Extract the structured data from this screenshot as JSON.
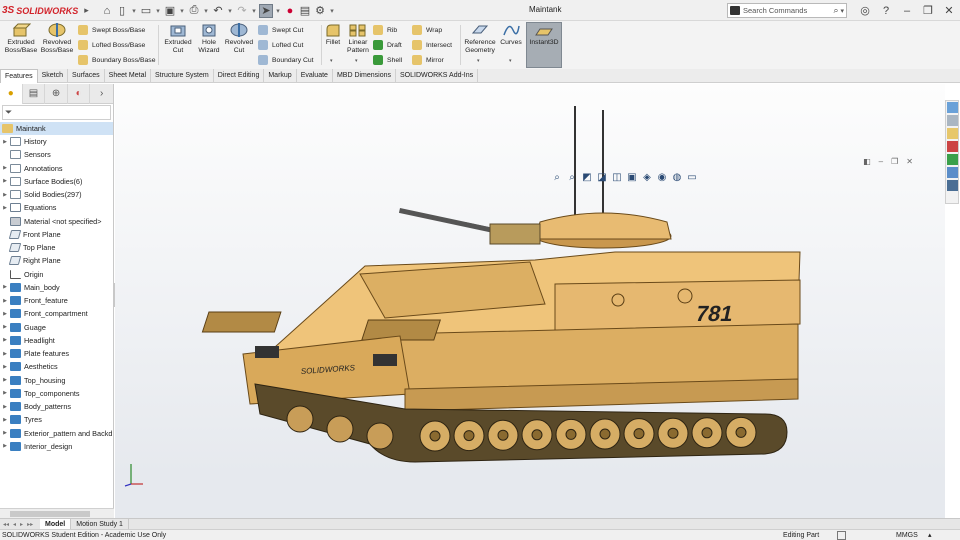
{
  "app": {
    "brand": "SOLIDWORKS",
    "window_title": "Maintank"
  },
  "search": {
    "placeholder": "Search Commands"
  },
  "ribbon": {
    "extruded_boss": "Extruded Boss/Base",
    "revolved_boss": "Revolved Boss/Base",
    "swept_boss": "Swept Boss/Base",
    "lofted_boss": "Lofted Boss/Base",
    "boundary_boss": "Boundary Boss/Base",
    "extruded_cut": "Extruded Cut",
    "hole_wizard": "Hole Wizard",
    "revolved_cut": "Revolved Cut",
    "swept_cut": "Swept Cut",
    "lofted_cut": "Lofted Cut",
    "boundary_cut": "Boundary Cut",
    "fillet": "Fillet",
    "linear_pattern": "Linear Pattern",
    "rib": "Rib",
    "draft": "Draft",
    "shell": "Shell",
    "wrap": "Wrap",
    "intersect": "Intersect",
    "mirror": "Mirror",
    "reference_geometry": "Reference Geometry",
    "curves": "Curves",
    "instant3d": "Instant3D"
  },
  "tabs": [
    "Features",
    "Sketch",
    "Surfaces",
    "Sheet Metal",
    "Structure System",
    "Direct Editing",
    "Markup",
    "Evaluate",
    "MBD Dimensions",
    "SOLIDWORKS Add-Ins"
  ],
  "tree": {
    "root": "Maintank",
    "items": [
      {
        "label": "History",
        "icon": "history-icon",
        "caret": true
      },
      {
        "label": "Sensors",
        "icon": "sensor-icon",
        "caret": false
      },
      {
        "label": "Annotations",
        "icon": "annotation-icon",
        "caret": true
      },
      {
        "label": "Surface Bodies(6)",
        "icon": "surface-bodies-icon",
        "caret": true
      },
      {
        "label": "Solid Bodies(297)",
        "icon": "solid-bodies-icon",
        "caret": true
      },
      {
        "label": "Equations",
        "icon": "equation-icon",
        "caret": true
      },
      {
        "label": "Material <not specified>",
        "icon": "material-icon",
        "caret": false
      },
      {
        "label": "Front Plane",
        "icon": "plane-icon",
        "caret": false
      },
      {
        "label": "Top Plane",
        "icon": "plane-icon",
        "caret": false
      },
      {
        "label": "Right Plane",
        "icon": "plane-icon",
        "caret": false
      },
      {
        "label": "Origin",
        "icon": "origin-icon",
        "caret": false
      },
      {
        "label": "Main_body",
        "icon": "folder-icon",
        "caret": true
      },
      {
        "label": "Front_feature",
        "icon": "folder-icon",
        "caret": true
      },
      {
        "label": "Front_compartment",
        "icon": "folder-icon",
        "caret": true
      },
      {
        "label": "Guage",
        "icon": "folder-icon",
        "caret": true
      },
      {
        "label": "Headlight",
        "icon": "folder-icon",
        "caret": true
      },
      {
        "label": "Plate features",
        "icon": "folder-icon",
        "caret": true
      },
      {
        "label": "Aesthetics",
        "icon": "folder-icon",
        "caret": true
      },
      {
        "label": "Top_housing",
        "icon": "folder-icon",
        "caret": true
      },
      {
        "label": "Top_components",
        "icon": "folder-icon",
        "caret": true
      },
      {
        "label": "Body_patterns",
        "icon": "folder-icon",
        "caret": true
      },
      {
        "label": "Tyres",
        "icon": "folder-icon",
        "caret": true
      },
      {
        "label": "Exterior_pattern and Backd",
        "icon": "folder-icon",
        "caret": true
      },
      {
        "label": "Interior_design",
        "icon": "folder-icon",
        "caret": true
      }
    ]
  },
  "model": {
    "decal_text": "SOLIDWORKS",
    "hull_number": "781",
    "body_color": "#e6b870"
  },
  "bottom_tabs": [
    "Model",
    "Motion Study 1"
  ],
  "status": {
    "left": "SOLIDWORKS Student Edition - Academic Use Only",
    "mode": "Editing Part",
    "units": "MMGS"
  },
  "colors": {
    "accent": "#d2232a",
    "selection": "#cfe2f5",
    "folder": "#3a7fc1"
  }
}
